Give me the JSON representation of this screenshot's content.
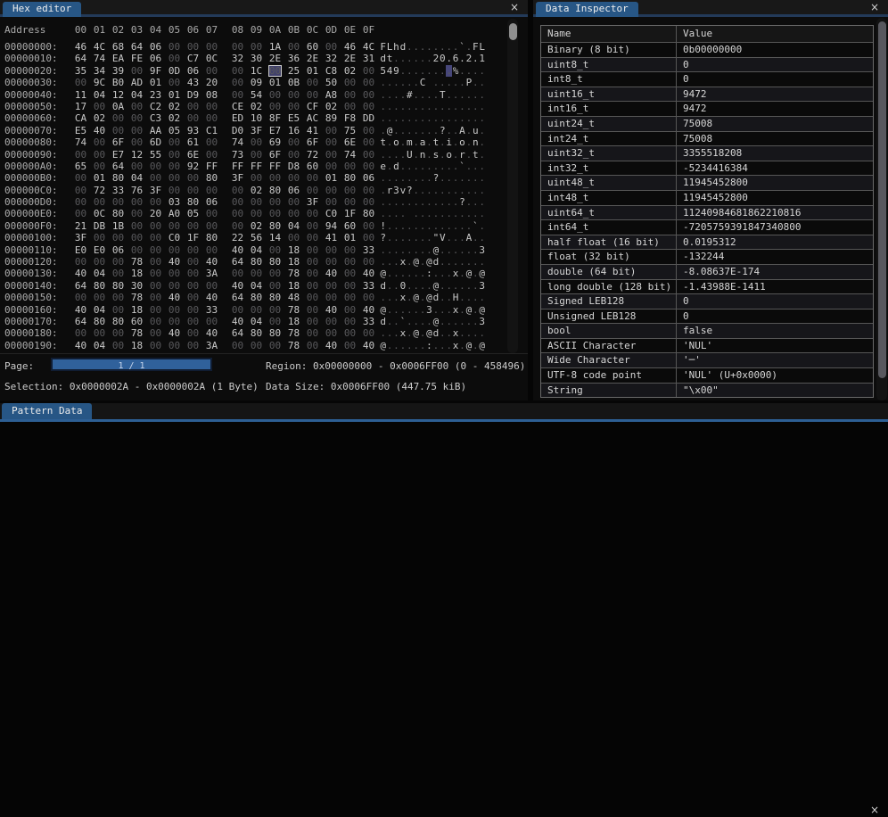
{
  "colors": {
    "tab_color": "#275685",
    "tab_underline": "#233a59",
    "accent_line": "#2d5f94",
    "selection_bg": "#41416b",
    "progress_fill": "#30619b",
    "dim_text": "#59595c"
  },
  "icons": {
    "close": "×"
  },
  "hex_editor": {
    "tab_title": "Hex editor",
    "address_header": "Address",
    "byte_headers": [
      "00",
      "01",
      "02",
      "03",
      "04",
      "05",
      "06",
      "07",
      "08",
      "09",
      "0A",
      "0B",
      "0C",
      "0D",
      "0E",
      "0F"
    ],
    "selection": {
      "row_index": 2,
      "byte_index": 10
    },
    "rows": [
      {
        "address": "00000000:",
        "bytes": [
          "46",
          "4C",
          "68",
          "64",
          "06",
          "00",
          "00",
          "00",
          "00",
          "00",
          "1A",
          "00",
          "60",
          "00",
          "46",
          "4C"
        ]
      },
      {
        "address": "00000010:",
        "bytes": [
          "64",
          "74",
          "EA",
          "FE",
          "06",
          "00",
          "C7",
          "0C",
          "32",
          "30",
          "2E",
          "36",
          "2E",
          "32",
          "2E",
          "31"
        ]
      },
      {
        "address": "00000020:",
        "bytes": [
          "35",
          "34",
          "39",
          "00",
          "9F",
          "0D",
          "06",
          "00",
          "00",
          "1C",
          "00",
          "25",
          "01",
          "C8",
          "02",
          "00"
        ]
      },
      {
        "address": "00000030:",
        "bytes": [
          "00",
          "9C",
          "B0",
          "AD",
          "01",
          "00",
          "43",
          "20",
          "00",
          "09",
          "01",
          "0B",
          "00",
          "50",
          "00",
          "00"
        ]
      },
      {
        "address": "00000040:",
        "bytes": [
          "11",
          "04",
          "12",
          "04",
          "23",
          "01",
          "D9",
          "08",
          "00",
          "54",
          "00",
          "00",
          "00",
          "A8",
          "00",
          "00"
        ]
      },
      {
        "address": "00000050:",
        "bytes": [
          "17",
          "00",
          "0A",
          "00",
          "C2",
          "02",
          "00",
          "00",
          "CE",
          "02",
          "00",
          "00",
          "CF",
          "02",
          "00",
          "00"
        ]
      },
      {
        "address": "00000060:",
        "bytes": [
          "CA",
          "02",
          "00",
          "00",
          "C3",
          "02",
          "00",
          "00",
          "ED",
          "10",
          "8F",
          "E5",
          "AC",
          "89",
          "F8",
          "DD"
        ]
      },
      {
        "address": "00000070:",
        "bytes": [
          "E5",
          "40",
          "00",
          "00",
          "AA",
          "05",
          "93",
          "C1",
          "D0",
          "3F",
          "E7",
          "16",
          "41",
          "00",
          "75",
          "00"
        ]
      },
      {
        "address": "00000080:",
        "bytes": [
          "74",
          "00",
          "6F",
          "00",
          "6D",
          "00",
          "61",
          "00",
          "74",
          "00",
          "69",
          "00",
          "6F",
          "00",
          "6E",
          "00"
        ]
      },
      {
        "address": "00000090:",
        "bytes": [
          "00",
          "00",
          "E7",
          "12",
          "55",
          "00",
          "6E",
          "00",
          "73",
          "00",
          "6F",
          "00",
          "72",
          "00",
          "74",
          "00"
        ]
      },
      {
        "address": "000000A0:",
        "bytes": [
          "65",
          "00",
          "64",
          "00",
          "00",
          "00",
          "92",
          "FF",
          "FF",
          "FF",
          "FF",
          "D8",
          "60",
          "00",
          "00",
          "00"
        ]
      },
      {
        "address": "000000B0:",
        "bytes": [
          "00",
          "01",
          "80",
          "04",
          "00",
          "00",
          "00",
          "80",
          "3F",
          "00",
          "00",
          "00",
          "00",
          "01",
          "80",
          "06"
        ]
      },
      {
        "address": "000000C0:",
        "bytes": [
          "00",
          "72",
          "33",
          "76",
          "3F",
          "00",
          "00",
          "00",
          "00",
          "02",
          "80",
          "06",
          "00",
          "00",
          "00",
          "00"
        ]
      },
      {
        "address": "000000D0:",
        "bytes": [
          "00",
          "00",
          "00",
          "00",
          "00",
          "03",
          "80",
          "06",
          "00",
          "00",
          "00",
          "00",
          "3F",
          "00",
          "00",
          "00"
        ]
      },
      {
        "address": "000000E0:",
        "bytes": [
          "00",
          "0C",
          "80",
          "00",
          "20",
          "A0",
          "05",
          "00",
          "00",
          "00",
          "00",
          "00",
          "00",
          "C0",
          "1F",
          "80"
        ]
      },
      {
        "address": "000000F0:",
        "bytes": [
          "21",
          "DB",
          "1B",
          "00",
          "00",
          "00",
          "00",
          "00",
          "00",
          "02",
          "80",
          "04",
          "00",
          "94",
          "60",
          "00"
        ]
      },
      {
        "address": "00000100:",
        "bytes": [
          "3F",
          "00",
          "00",
          "00",
          "00",
          "C0",
          "1F",
          "80",
          "22",
          "56",
          "14",
          "00",
          "00",
          "41",
          "01",
          "00"
        ]
      },
      {
        "address": "00000110:",
        "bytes": [
          "E0",
          "E0",
          "06",
          "00",
          "00",
          "00",
          "00",
          "00",
          "40",
          "04",
          "00",
          "18",
          "00",
          "00",
          "00",
          "33"
        ]
      },
      {
        "address": "00000120:",
        "bytes": [
          "00",
          "00",
          "00",
          "78",
          "00",
          "40",
          "00",
          "40",
          "64",
          "80",
          "80",
          "18",
          "00",
          "00",
          "00",
          "00"
        ]
      },
      {
        "address": "00000130:",
        "bytes": [
          "40",
          "04",
          "00",
          "18",
          "00",
          "00",
          "00",
          "3A",
          "00",
          "00",
          "00",
          "78",
          "00",
          "40",
          "00",
          "40"
        ]
      },
      {
        "address": "00000140:",
        "bytes": [
          "64",
          "80",
          "80",
          "30",
          "00",
          "00",
          "00",
          "00",
          "40",
          "04",
          "00",
          "18",
          "00",
          "00",
          "00",
          "33"
        ]
      },
      {
        "address": "00000150:",
        "bytes": [
          "00",
          "00",
          "00",
          "78",
          "00",
          "40",
          "00",
          "40",
          "64",
          "80",
          "80",
          "48",
          "00",
          "00",
          "00",
          "00"
        ]
      },
      {
        "address": "00000160:",
        "bytes": [
          "40",
          "04",
          "00",
          "18",
          "00",
          "00",
          "00",
          "33",
          "00",
          "00",
          "00",
          "78",
          "00",
          "40",
          "00",
          "40"
        ]
      },
      {
        "address": "00000170:",
        "bytes": [
          "64",
          "80",
          "80",
          "60",
          "00",
          "00",
          "00",
          "00",
          "40",
          "04",
          "00",
          "18",
          "00",
          "00",
          "00",
          "33"
        ]
      },
      {
        "address": "00000180:",
        "bytes": [
          "00",
          "00",
          "00",
          "78",
          "00",
          "40",
          "00",
          "40",
          "64",
          "80",
          "80",
          "78",
          "00",
          "00",
          "00",
          "00"
        ]
      },
      {
        "address": "00000190:",
        "bytes": [
          "40",
          "04",
          "00",
          "18",
          "00",
          "00",
          "00",
          "3A",
          "00",
          "00",
          "00",
          "78",
          "00",
          "40",
          "00",
          "40"
        ]
      }
    ],
    "footer": {
      "page_label": "Page:",
      "page_value": "1 / 1",
      "region_text": "Region: 0x00000000 - 0x0006FF00 (0 - 458496)",
      "selection_text": "Selection: 0x0000002A - 0x0000002A (1 Byte)",
      "data_size_text": "Data Size: 0x0006FF00 (447.75 kiB)"
    }
  },
  "data_inspector": {
    "tab_title": "Data Inspector",
    "columns": [
      "Name",
      "Value"
    ],
    "rows": [
      [
        "Binary (8 bit)",
        "0b00000000"
      ],
      [
        "uint8_t",
        "0"
      ],
      [
        "int8_t",
        "0"
      ],
      [
        "uint16_t",
        "9472"
      ],
      [
        "int16_t",
        "9472"
      ],
      [
        "uint24_t",
        "75008"
      ],
      [
        "int24_t",
        "75008"
      ],
      [
        "uint32_t",
        "3355518208"
      ],
      [
        "int32_t",
        "-5234416384"
      ],
      [
        "uint48_t",
        "11945452800"
      ],
      [
        "int48_t",
        "11945452800"
      ],
      [
        "uint64_t",
        "11240984681862210816"
      ],
      [
        "int64_t",
        "-7205759391847340800"
      ],
      [
        "half float (16 bit)",
        "0.0195312"
      ],
      [
        "float (32 bit)",
        "-132244"
      ],
      [
        "double (64 bit)",
        "-8.08637E-174"
      ],
      [
        "long double (128 bit)",
        "-1.43988E-1411"
      ],
      [
        "Signed LEB128",
        "0"
      ],
      [
        "Unsigned LEB128",
        "0"
      ],
      [
        "bool",
        "false"
      ],
      [
        "ASCII Character",
        "'NUL'"
      ],
      [
        "Wide Character",
        "'─'"
      ],
      [
        "UTF-8 code point",
        "'NUL' (U+0x0000)"
      ],
      [
        "String",
        "\"\\x00\""
      ]
    ]
  },
  "pattern_data": {
    "tab_title": "Pattern Data"
  }
}
